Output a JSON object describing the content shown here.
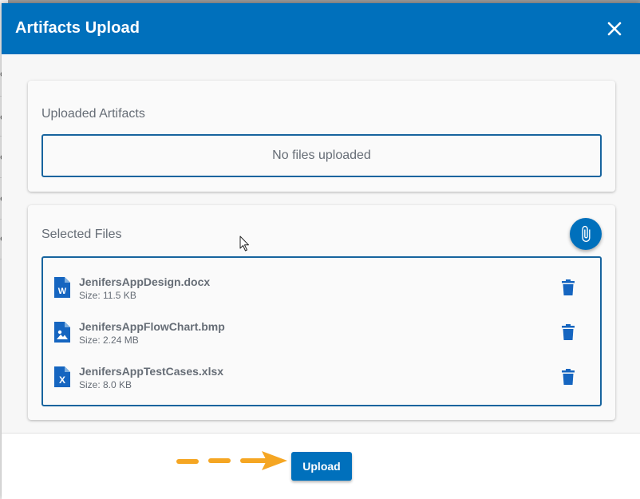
{
  "dialog": {
    "title": "Artifacts Upload",
    "close_icon": "close-icon",
    "accent_color": "#0070bc"
  },
  "uploaded_section": {
    "label": "Uploaded Artifacts",
    "empty_text": "No files uploaded"
  },
  "selected_section": {
    "label": "Selected Files",
    "attach_icon": "paperclip-icon",
    "files": [
      {
        "name": "JenifersAppDesign.docx",
        "size": "Size: 11.5 KB",
        "icon": "word-file-icon"
      },
      {
        "name": "JenifersAppFlowChart.bmp",
        "size": "Size: 2.24 MB",
        "icon": "image-file-icon"
      },
      {
        "name": "JenifersAppTestCases.xlsx",
        "size": "Size: 8.0 KB",
        "icon": "excel-file-icon"
      }
    ]
  },
  "footer": {
    "upload_label": "Upload",
    "annotation_arrow_color": "#f5a623"
  }
}
